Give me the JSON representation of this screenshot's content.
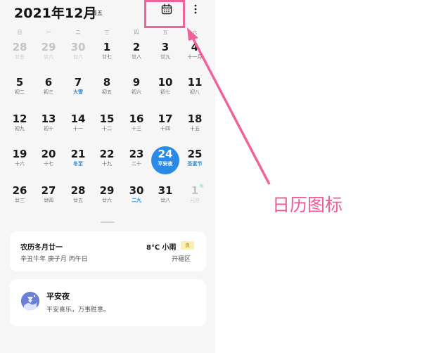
{
  "header": {
    "month": "2021年12月",
    "weekday": "周五"
  },
  "weekdays": [
    "日",
    "一",
    "二",
    "三",
    "四",
    "五",
    "六"
  ],
  "weeks": [
    [
      {
        "day": "28",
        "lunar": "廿五",
        "other": true
      },
      {
        "day": "29",
        "lunar": "廿六",
        "other": true
      },
      {
        "day": "30",
        "lunar": "廿六",
        "other": true
      },
      {
        "day": "1",
        "lunar": "廿七"
      },
      {
        "day": "2",
        "lunar": "廿八"
      },
      {
        "day": "3",
        "lunar": "廿九"
      },
      {
        "day": "4",
        "lunar": "十一月"
      }
    ],
    [
      {
        "day": "5",
        "lunar": "初二"
      },
      {
        "day": "6",
        "lunar": "初三"
      },
      {
        "day": "7",
        "lunar": "大雪",
        "term": true
      },
      {
        "day": "8",
        "lunar": "初五"
      },
      {
        "day": "9",
        "lunar": "初六"
      },
      {
        "day": "10",
        "lunar": "初七"
      },
      {
        "day": "11",
        "lunar": "初八"
      }
    ],
    [
      {
        "day": "12",
        "lunar": "初九"
      },
      {
        "day": "13",
        "lunar": "初十"
      },
      {
        "day": "14",
        "lunar": "十一"
      },
      {
        "day": "15",
        "lunar": "十二"
      },
      {
        "day": "16",
        "lunar": "十三"
      },
      {
        "day": "17",
        "lunar": "十四"
      },
      {
        "day": "18",
        "lunar": "十五"
      }
    ],
    [
      {
        "day": "19",
        "lunar": "十六"
      },
      {
        "day": "20",
        "lunar": "十七"
      },
      {
        "day": "21",
        "lunar": "冬至",
        "term": true
      },
      {
        "day": "22",
        "lunar": "十九"
      },
      {
        "day": "23",
        "lunar": "二十"
      },
      {
        "day": "24",
        "lunar": "平安夜",
        "today": true
      },
      {
        "day": "25",
        "lunar": "圣诞节",
        "term": true
      }
    ],
    [
      {
        "day": "26",
        "lunar": "廿三"
      },
      {
        "day": "27",
        "lunar": "廿四"
      },
      {
        "day": "28",
        "lunar": "廿五"
      },
      {
        "day": "29",
        "lunar": "廿六"
      },
      {
        "day": "30",
        "lunar": "二九",
        "term": true
      },
      {
        "day": "31",
        "lunar": "廿八"
      },
      {
        "day": "1",
        "lunar": "元旦",
        "other": true,
        "badge": "班"
      }
    ]
  ],
  "info_card": {
    "lunar_date": "农历冬月廿一",
    "ganzhi": "辛丑牛年 庚子月 丙午日",
    "weather": "8℃ 小雨",
    "aqi": "良",
    "district": "开福区"
  },
  "event_card": {
    "title": "平安夜",
    "subtitle": "平安喜乐，万事胜意。"
  },
  "annotation": {
    "text": "日历图标",
    "color": "#ee5a98"
  },
  "colors": {
    "accent": "#2b8ae8",
    "term": "#2d8fd9",
    "highlight": "#f0629b"
  },
  "icons": {
    "calendar": "calendar-icon",
    "more": "more-vertical-icon"
  }
}
